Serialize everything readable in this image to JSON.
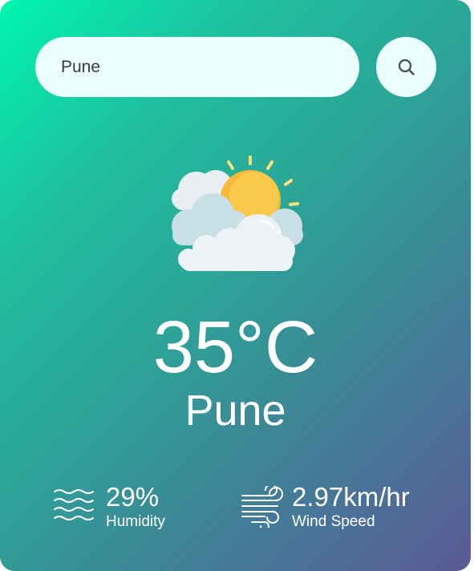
{
  "search": {
    "value": "Pune",
    "icon": "search-icon"
  },
  "weather": {
    "icon": "partly-cloudy-icon",
    "temperature": "35°C",
    "city": "Pune"
  },
  "details": {
    "humidity": {
      "value": "29%",
      "label": "Humidity",
      "icon": "humidity-waves-icon"
    },
    "wind": {
      "value": "2.97km/hr",
      "label": "Wind Speed",
      "icon": "wind-icon"
    }
  },
  "colors": {
    "gradient_start": "#00f5b0",
    "gradient_end": "#5b5a94",
    "input_background": "#ebfffc",
    "text": "#ffffff"
  }
}
